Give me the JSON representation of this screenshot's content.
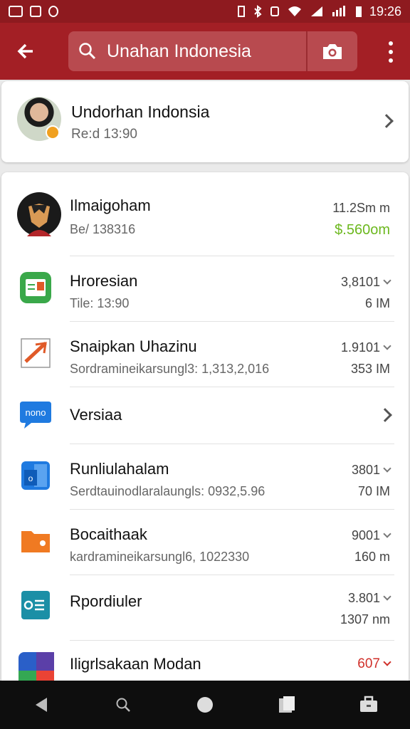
{
  "status_bar": {
    "time": "19:26"
  },
  "app_bar": {
    "search_text": "Unahan Indonesia",
    "back_icon": "arrow-left-icon",
    "camera_icon": "camera-icon",
    "more_icon": "more-vert-icon"
  },
  "header_card": {
    "title": "Undorhan Indonsia",
    "subtitle": "Re:d 13:90"
  },
  "list": [
    {
      "icon": "person-avatar",
      "title": "Ilmaigoham",
      "subtitle": "Be/ 138316",
      "value1": "11.2Sm m",
      "value2": "$.560om",
      "value2_color": "#6cb81e"
    },
    {
      "icon": "green-app-icon",
      "title": "Hroresian",
      "subtitle": "Tile: 13:90",
      "value1": "3,8101",
      "value2": "6 IM"
    },
    {
      "icon": "edit-doc-icon",
      "title": "Snaipkan Uhazinu",
      "subtitle": "Sordramineikarsungl3: 1,313,2,016",
      "value1": "1.9101",
      "value2": "353 IM"
    },
    {
      "icon": "blue-chat-icon",
      "title": "Versiaa",
      "subtitle": "",
      "value1": "",
      "value2": ""
    },
    {
      "icon": "blue-doc-icon",
      "title": "Runliulahalam",
      "subtitle": "Serdtauinodlaralaungls: 0932,5.96",
      "value1": "3801",
      "value2": "70 IM"
    },
    {
      "icon": "orange-folder-icon",
      "title": "Bocaithaak",
      "subtitle": "kardramineikarsungl6, 1022330",
      "value1": "9001",
      "value2": "160 m"
    },
    {
      "icon": "teal-list-icon",
      "title": "Rpordiuler",
      "subtitle": "",
      "value1": "3.801",
      "value2": "1307 nm"
    },
    {
      "icon": "multicolor-app-icon",
      "title": "Iligrlsakaan Modan",
      "subtitle": "",
      "value1": "607",
      "value2": "",
      "value1_color": "#d0302a"
    }
  ],
  "nav_bar": {
    "back": "back-triangle-icon",
    "search": "search-icon",
    "home": "home-circle-icon",
    "recents": "recents-square-icon",
    "briefcase": "briefcase-icon"
  }
}
